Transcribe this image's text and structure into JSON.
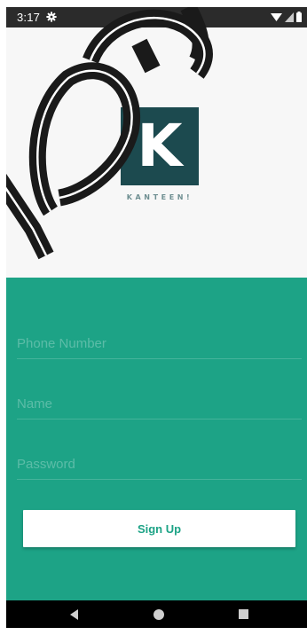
{
  "status_bar": {
    "time": "3:17",
    "icons": [
      "gear-icon",
      "wifi-icon",
      "signal-icon",
      "battery-icon"
    ]
  },
  "logo": {
    "letter": "K",
    "caption": "KANTEEN!"
  },
  "form": {
    "phone": {
      "placeholder": "Phone Number",
      "value": ""
    },
    "name": {
      "placeholder": "Name",
      "value": ""
    },
    "password": {
      "placeholder": "Password",
      "value": ""
    },
    "signup_label": "Sign Up"
  },
  "colors": {
    "accent": "#1da386",
    "logo_background": "#1c4a4f",
    "status_bar": "#2b2b2b",
    "header_background": "#f7f7f7"
  },
  "nav_bar": {
    "icons": [
      "back-icon",
      "home-icon",
      "recents-icon"
    ]
  }
}
